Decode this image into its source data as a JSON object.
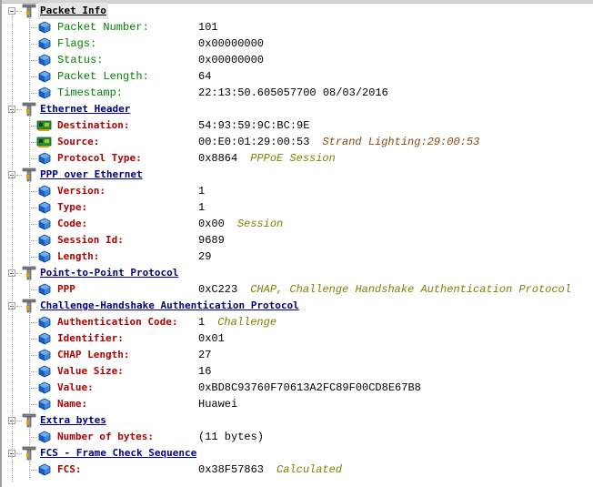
{
  "sections": [
    {
      "title": "Packet Info",
      "fields": [
        {
          "label": "Packet Number:",
          "value": "101",
          "note": "",
          "icon": "cube-icon"
        },
        {
          "label": "Flags:",
          "value": "0x00000000",
          "note": "",
          "icon": "cube-icon"
        },
        {
          "label": "Status:",
          "value": "0x00000000",
          "note": "",
          "icon": "cube-icon"
        },
        {
          "label": "Packet Length:",
          "value": "64",
          "note": "",
          "icon": "cube-icon"
        },
        {
          "label": "Timestamp:",
          "value": "22:13:50.605057700 08/03/2016",
          "note": "",
          "icon": "cube-icon"
        }
      ]
    },
    {
      "title": "Ethernet Header",
      "fields": [
        {
          "label": "Destination:",
          "value": "54:93:59:9C:BC:9E",
          "note": "",
          "icon": "network-card-icon"
        },
        {
          "label": "Source:",
          "value": "00:E0:01:29:00:53",
          "note": "Strand Lighting:29:00:53",
          "icon": "network-card-icon"
        },
        {
          "label": "Protocol Type:",
          "value": "0x8864",
          "note": "PPPoE Session",
          "icon": "cube-icon"
        }
      ]
    },
    {
      "title": "PPP over Ethernet",
      "fields": [
        {
          "label": "Version:",
          "value": "1",
          "note": "",
          "icon": "cube-icon"
        },
        {
          "label": "Type:",
          "value": "1",
          "note": "",
          "icon": "cube-icon"
        },
        {
          "label": "Code:",
          "value": "0x00",
          "note": "Session",
          "icon": "cube-icon"
        },
        {
          "label": "Session Id:",
          "value": "9689",
          "note": "",
          "icon": "cube-icon"
        },
        {
          "label": "Length:",
          "value": "29",
          "note": "",
          "icon": "cube-icon"
        }
      ]
    },
    {
      "title": "Point-to-Point Protocol",
      "fields": [
        {
          "label": "PPP",
          "value": "0xC223",
          "note": "CHAP, Challenge Handshake Authentication Protocol",
          "icon": "cube-icon"
        }
      ]
    },
    {
      "title": "Challenge-Handshake Authentication Protocol",
      "fields": [
        {
          "label": "Authentication Code:",
          "value": "1",
          "note": "Challenge",
          "icon": "cube-icon"
        },
        {
          "label": "Identifier:",
          "value": "0x01",
          "note": "",
          "icon": "cube-icon"
        },
        {
          "label": "CHAP Length:",
          "value": "27",
          "note": "",
          "icon": "cube-icon"
        },
        {
          "label": "Value Size:",
          "value": "16",
          "note": "",
          "icon": "cube-icon"
        },
        {
          "label": "Value:",
          "value": "0xBD8C93760F70613A2FC89F00CD8E67B8",
          "note": "",
          "icon": "cube-icon"
        },
        {
          "label": "Name:",
          "value": "Huawei",
          "note": "",
          "icon": "cube-icon"
        }
      ]
    },
    {
      "title": "Extra bytes",
      "fields": [
        {
          "label": "Number of bytes:",
          "value": "(11 bytes)",
          "note": "",
          "icon": "cube-icon"
        }
      ]
    },
    {
      "title": "FCS - Frame Check Sequence",
      "fields": [
        {
          "label": "FCS:",
          "value": "0x38F57863",
          "note": "Calculated",
          "icon": "cube-icon"
        }
      ]
    }
  ]
}
